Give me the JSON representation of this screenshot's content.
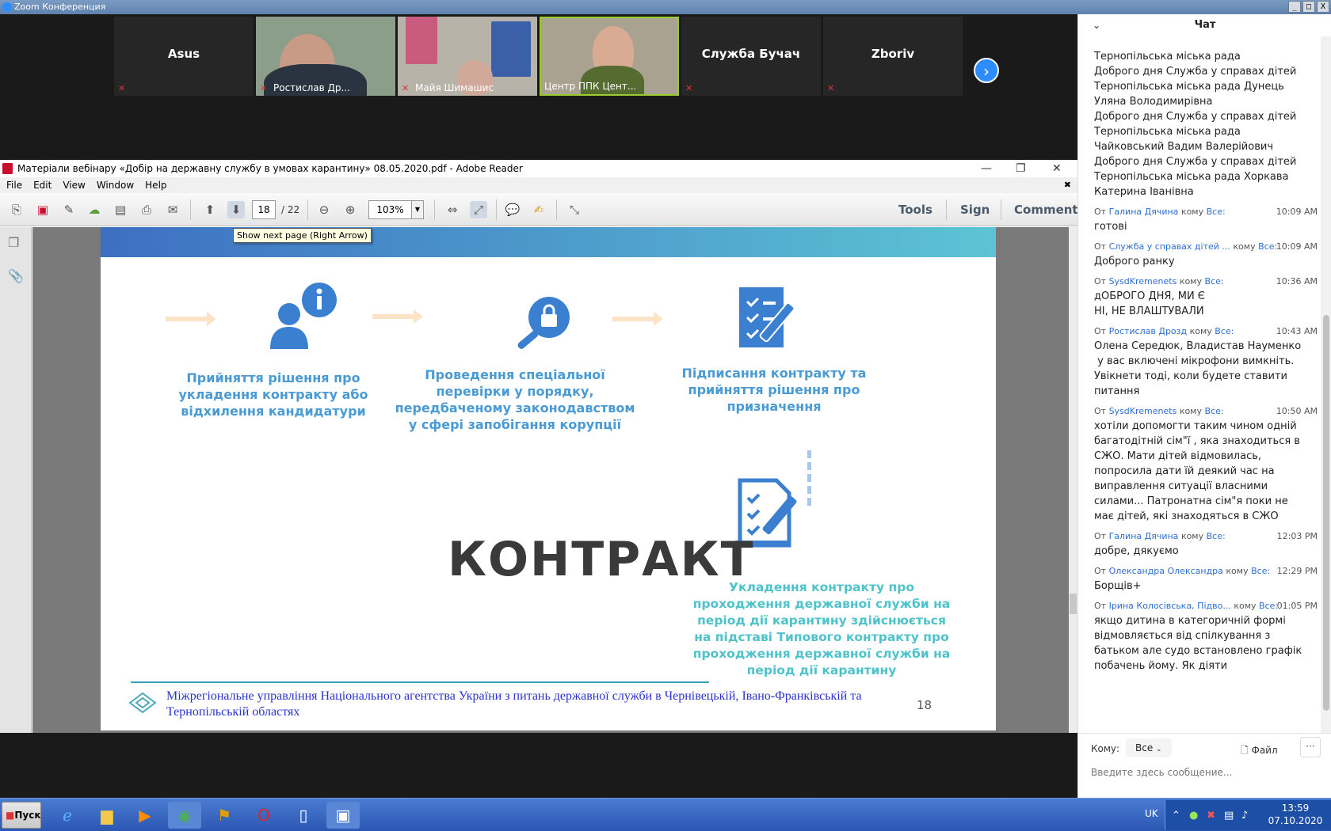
{
  "window": {
    "title": "Zoom Конференция"
  },
  "participants": [
    {
      "name": "Asus",
      "video": false
    },
    {
      "name": "Ростислав Др...",
      "video": true
    },
    {
      "name": "Майя Шимашис",
      "video": true
    },
    {
      "name": "Центр ППК Цент...",
      "video": true,
      "active": true
    },
    {
      "name": "Служба Бучач",
      "video": false
    },
    {
      "name": "Zboriv",
      "video": false
    }
  ],
  "reader": {
    "title": "Матеріали вебінару «Добір на державну службу в умовах карантину» 08.05.2020.pdf - Adobe Reader",
    "menu": [
      "File",
      "Edit",
      "View",
      "Window",
      "Help"
    ],
    "page_current": "18",
    "page_total": "/ 22",
    "zoom": "103%",
    "right_tools": [
      "Tools",
      "Sign",
      "Comment"
    ],
    "tooltip": "Show next page (Right Arrow)"
  },
  "slide": {
    "step1": "Прийняття рішення про укладення контракту або відхилення кандидатури",
    "step2": "Проведення спеціальної перевірки у порядку, передбаченому законодавством у сфері запобігання корупції",
    "step3": "Підписання контракту та прийняття рішення про призначення",
    "step4": "Укладення контракту про проходження державної служби на період дії карантину здійснюється на підставі Типового контракту про проходження державної служби на період дії карантину",
    "big_word": "КОНТРАКТ",
    "footer": "Міжрегіональне управління Національного агентства України з питань державної служби в Чернівецькій, Івано-Франківській та Тернопільській областях",
    "page_number": "18"
  },
  "chat": {
    "title": "Чат",
    "intro_lines": [
      "Тернопільська міська рада",
      "Доброго дня Служба у справах дітей",
      "Тернопільська міська рада Дунець",
      "Уляна Володимирівна",
      "Доброго дня Служба у справах дітей",
      "Тернопільська міська рада",
      "Чайковський Вадим Валерійович",
      "Доброго дня Служба у справах дітей",
      "Тернопільська міська рада Хоркава",
      "Катерина Іванівна"
    ],
    "from_word": "От",
    "to_word": "кому",
    "messages": [
      {
        "from": "Галина Дячина",
        "to": "Все:",
        "time": "10:09 AM",
        "lines": [
          "готові"
        ]
      },
      {
        "from": "Служба у справах дітей ...",
        "to": "Все:",
        "time": "10:09 AM",
        "lines": [
          "Доброго ранку"
        ]
      },
      {
        "from": "SysdKremenets",
        "to": "Все:",
        "time": "10:36 AM",
        "lines": [
          "дОБРОГО ДНЯ, МИ Є",
          "НІ, НЕ ВЛАШТУВАЛИ"
        ]
      },
      {
        "from": "Ростислав Дрозд",
        "to": "Все:",
        "time": "10:43 AM",
        "lines": [
          "Олена Середюк, Владистав Науменко",
          " у вас включені мікрофони вимкніть.",
          "Увікнети тоді, коли будете ставити",
          "питання"
        ]
      },
      {
        "from": "SysdKremenets",
        "to": "Все:",
        "time": "10:50 AM",
        "lines": [
          "хотіли допомогти таким чином одній",
          "багатодітній сім\"ї , яка знаходиться в",
          "СЖО. Мати дітей відмовилась,",
          "попросила дати їй деякий час на",
          "виправлення ситуації власними",
          "силами... Патронатна сім\"я поки не",
          "має дітей, які знаходяться в СЖО"
        ]
      },
      {
        "from": "Галина Дячина",
        "to": "Все:",
        "time": "12:03 PM",
        "lines": [
          "добре, дякуємо"
        ]
      },
      {
        "from": "Олександра Олександра",
        "to": "Все:",
        "time": "12:29 PM",
        "lines": [
          "Борщів+"
        ]
      },
      {
        "from": "Ірина Колосівська, Підво...",
        "to": "Все:",
        "time": "01:05 PM",
        "lines": [
          "якщо дитина в категоричній формі",
          "відмовляється від спілкування з",
          "батьком але судо встановлено графік",
          "побачень йому. Як діяти"
        ]
      }
    ],
    "to_label": "Кому:",
    "to_value": "Все",
    "file_label": "Файл",
    "placeholder": "Введите здесь сообщение..."
  },
  "taskbar": {
    "start": "Пуск",
    "lang": "UK",
    "time": "13:59",
    "date": "07.10.2020"
  }
}
